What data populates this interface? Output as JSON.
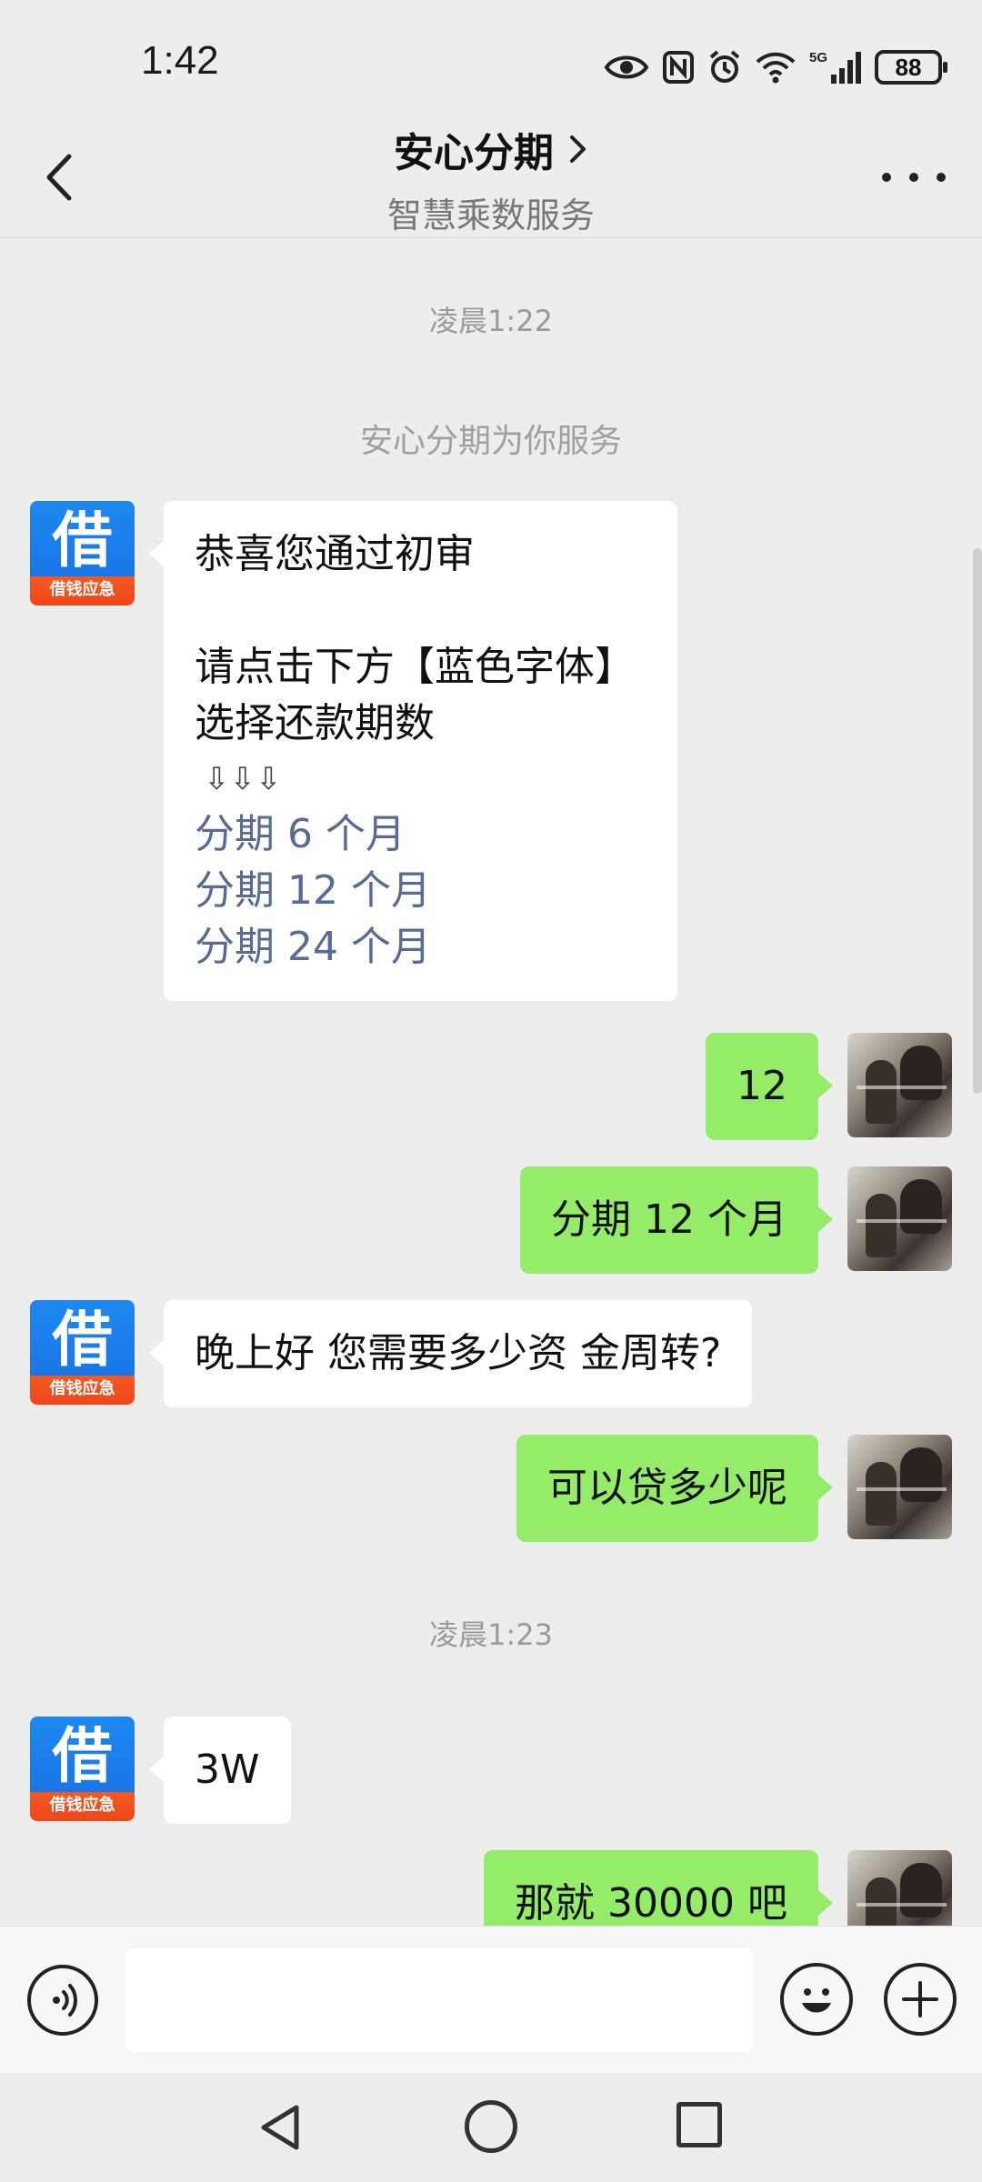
{
  "status_bar": {
    "time": "1:42",
    "network": "5G",
    "battery": "88"
  },
  "header": {
    "title": "安心分期",
    "subtitle": "智慧乘数服务"
  },
  "chat": {
    "timestamp_1": "凌晨1:22",
    "system_message": "安心分期为你服务",
    "msg_1": {
      "line1": "恭喜您通过初审",
      "line2": "请点击下方【蓝色字体】",
      "line3": "选择还款期数",
      "arrows": "⇩⇩⇩",
      "option_1": "分期 6 个月",
      "option_2": "分期 12 个月",
      "option_3": "分期 24 个月"
    },
    "msg_2": "12",
    "msg_3": "分期 12 个月",
    "msg_4": "晚上好  您需要多少资 金周转?",
    "msg_5": "可以贷多少呢",
    "timestamp_2": "凌晨1:23",
    "msg_6": "3W",
    "msg_7": "那就 30000 吧"
  },
  "bot_avatar": {
    "big_char": "借",
    "small_text": "借钱应急",
    "colors": {
      "top": "#1E88F0",
      "bottom": "#F25A22"
    }
  },
  "colors": {
    "background": "#EDEDED",
    "sent_bubble": "#95EC69",
    "received_bubble": "#FFFFFF",
    "link_text": "#576B95"
  },
  "icons": {
    "back": "chevron-left-icon",
    "more": "more-dots-icon",
    "voice": "voice-icon",
    "emoji": "emoji-icon",
    "plus": "plus-icon"
  }
}
